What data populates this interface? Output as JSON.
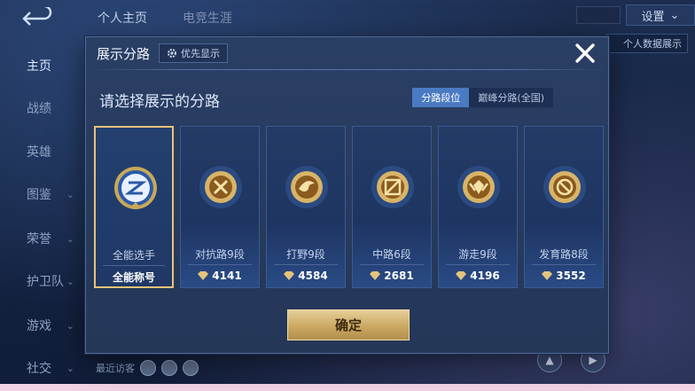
{
  "top_nav": {
    "tab1": "个人主页",
    "tab2": "电竞生涯"
  },
  "top_right": {
    "settings_label": "设置",
    "detail_tag": "个人数据展示"
  },
  "sidebar": {
    "items": [
      {
        "label": "主页",
        "has_chevron": false
      },
      {
        "label": "战绩",
        "has_chevron": false
      },
      {
        "label": "英雄",
        "has_chevron": false
      },
      {
        "label": "图鉴",
        "has_chevron": true
      },
      {
        "label": "荣誉",
        "has_chevron": true
      },
      {
        "label": "护卫队",
        "has_chevron": true
      },
      {
        "label": "游戏",
        "has_chevron": true
      },
      {
        "label": "社交",
        "has_chevron": true
      }
    ]
  },
  "visitors_label": "最近访客",
  "modal": {
    "title": "展示分路",
    "priority_label": "优先显示",
    "subtitle": "请选择展示的分路",
    "segments": {
      "on": "分路段位",
      "off": "巅峰分路(全国)"
    },
    "confirm_label": "确定",
    "cards": [
      {
        "label": "全能选手",
        "score": "全能称号",
        "selected": true
      },
      {
        "label": "对抗路9段",
        "score": "4141",
        "selected": false
      },
      {
        "label": "打野9段",
        "score": "4584",
        "selected": false
      },
      {
        "label": "中路6段",
        "score": "2681",
        "selected": false
      },
      {
        "label": "游走9段",
        "score": "4196",
        "selected": false
      },
      {
        "label": "发育路8段",
        "score": "3552",
        "selected": false
      }
    ]
  },
  "colors": {
    "gold": "#e9c27a",
    "accent_blue": "#4a7ac2",
    "panel": "#2a3f64"
  }
}
